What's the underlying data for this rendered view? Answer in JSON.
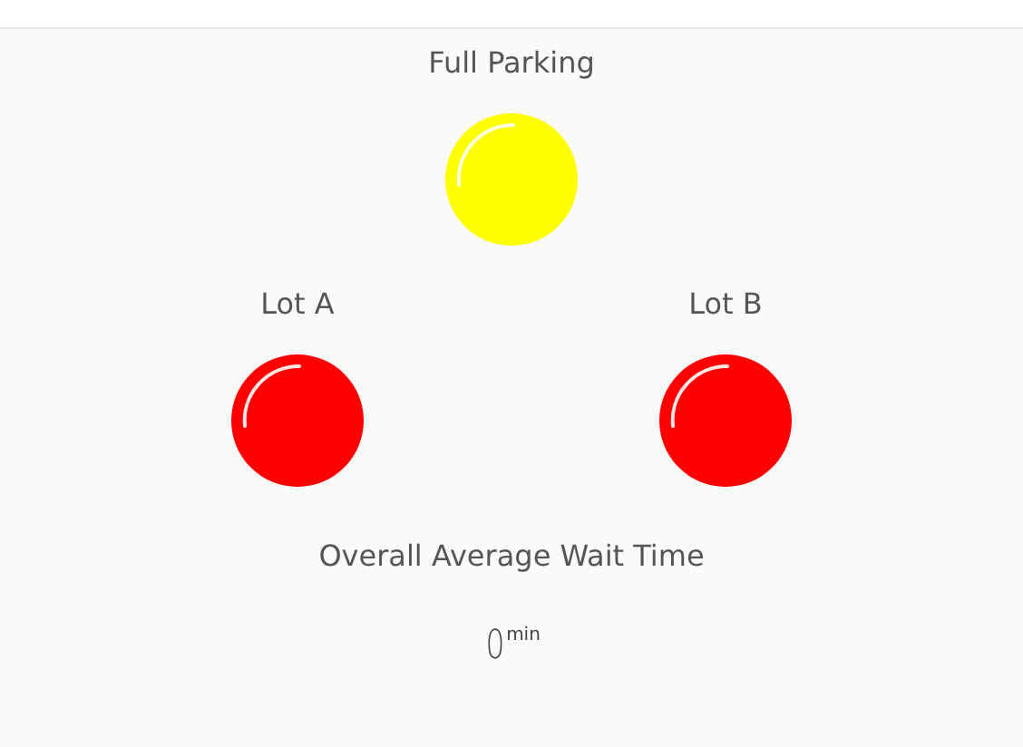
{
  "main_light": {
    "label": "Full Parking",
    "color": "#ffff00"
  },
  "lots": [
    {
      "label": "Lot A",
      "color": "#ff0000"
    },
    {
      "label": "Lot B",
      "color": "#ff0000"
    }
  ],
  "wait_time": {
    "title": "Overall Average Wait Time",
    "value": "0",
    "unit": "min"
  }
}
